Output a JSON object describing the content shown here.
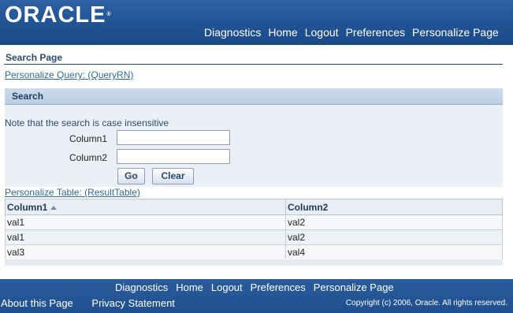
{
  "header": {
    "logo_text": "ORACLE",
    "logo_mark": "®",
    "global_links": [
      "Diagnostics",
      "Home",
      "Logout",
      "Preferences",
      "Personalize Page"
    ]
  },
  "page": {
    "title": "Search Page",
    "personalize_query_link": "Personalize Query: (QueryRN)"
  },
  "search": {
    "header": "Search",
    "note": "Note that the search is case insensitive",
    "column1_label": "Column1",
    "column1_value": "",
    "column2_label": "Column2",
    "column2_value": "",
    "go_label": "Go",
    "clear_label": "Clear"
  },
  "results": {
    "personalize_table_link": "Personalize Table: (ResultTable)",
    "headers": [
      "Column1",
      "Column2"
    ],
    "sort_icon": "sort-ascending-icon",
    "rows": [
      [
        "val1",
        "val2"
      ],
      [
        "val1",
        "val2"
      ],
      [
        "val3",
        "val4"
      ]
    ]
  },
  "footer": {
    "links": [
      "Diagnostics",
      "Home",
      "Logout",
      "Preferences",
      "Personalize Page"
    ],
    "about": "About this Page",
    "privacy": "Privacy Statement",
    "copyright": "Copyright (c) 2006, Oracle. All rights reserved."
  },
  "colors": {
    "header_bg": "#225596",
    "link": "#2f6b96",
    "title": "#2a4a72",
    "panel_bg": "#ebf0f6"
  }
}
